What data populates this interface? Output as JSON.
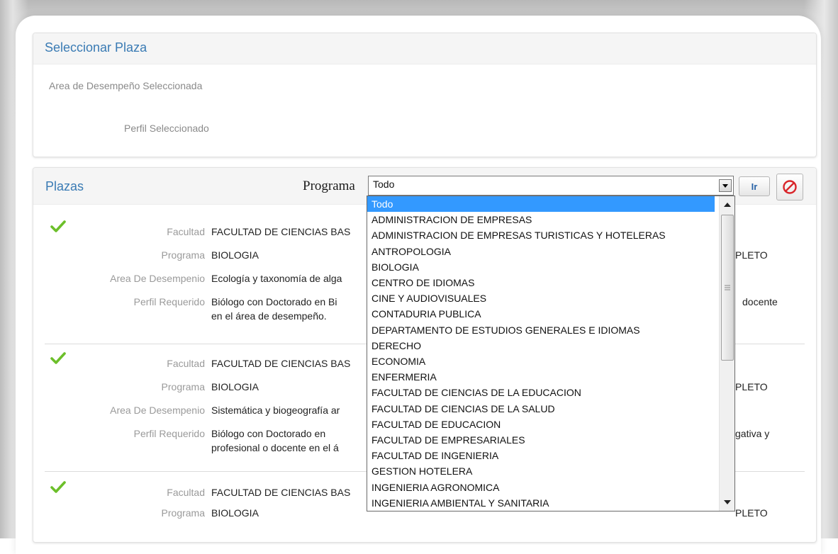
{
  "seleccionar": {
    "title": "Seleccionar Plaza",
    "area_label": "Area de Desempeño Seleccionada",
    "perfil_label": "Perfil Seleccionado"
  },
  "plazas": {
    "title": "Plazas",
    "programa_label": "Programa",
    "programa_selected": "Todo",
    "ir_label": "Ir",
    "labels": {
      "facultad": "Facultad",
      "programa": "Programa",
      "area": "Area De Desempenio",
      "perfil": "Perfil Requerido"
    },
    "records": [
      {
        "facultad": "FACULTAD DE CIENCIAS BAS",
        "programa": "BIOLOGIA",
        "area": "Ecología y taxonomía de alga",
        "perfil_line1": "Biólogo con Doctorado en Bi",
        "perfil_line2": "en el área de desempeño.",
        "right_top": "PLETO",
        "right_perfil": "docente"
      },
      {
        "facultad": "FACULTAD DE CIENCIAS BAS",
        "programa": "BIOLOGIA",
        "area": "Sistemática y biogeografía ar",
        "perfil_line1": "Biólogo  con  Doctorado  en",
        "perfil_line2": "profesional o docente en el á",
        "right_top": "PLETO",
        "right_perfil": "gativa  y"
      },
      {
        "facultad": "FACULTAD DE CIENCIAS BAS",
        "programa": "BIOLOGIA",
        "right_top": "PLETO"
      }
    ]
  },
  "dropdown": {
    "options": [
      "Todo",
      "ADMINISTRACION DE EMPRESAS",
      "ADMINISTRACION DE EMPRESAS TURISTICAS Y HOTELERAS",
      "ANTROPOLOGIA",
      "BIOLOGIA",
      "CENTRO DE IDIOMAS",
      "CINE Y AUDIOVISUALES",
      "CONTADURIA PUBLICA",
      "DEPARTAMENTO DE ESTUDIOS GENERALES E IDIOMAS",
      "DERECHO",
      "ECONOMIA",
      "ENFERMERIA",
      "FACULTAD DE CIENCIAS DE LA EDUCACION",
      "FACULTAD DE CIENCIAS DE LA SALUD",
      "FACULTAD DE EDUCACION",
      "FACULTAD DE EMPRESARIALES",
      "FACULTAD DE INGENIERIA",
      "GESTION HOTELERA",
      "INGENIERIA AGRONOMICA",
      "INGENIERIA AMBIENTAL Y SANITARIA"
    ]
  },
  "colors": {
    "title_blue": "#3a7bb4",
    "selection_blue": "#3399ff",
    "check_green": "#6cbf2a",
    "cancel_red": "#d9262b"
  },
  "icons": {
    "check": "check-icon",
    "cancel": "cancel-icon",
    "dropdown": "chevron-down-icon"
  }
}
